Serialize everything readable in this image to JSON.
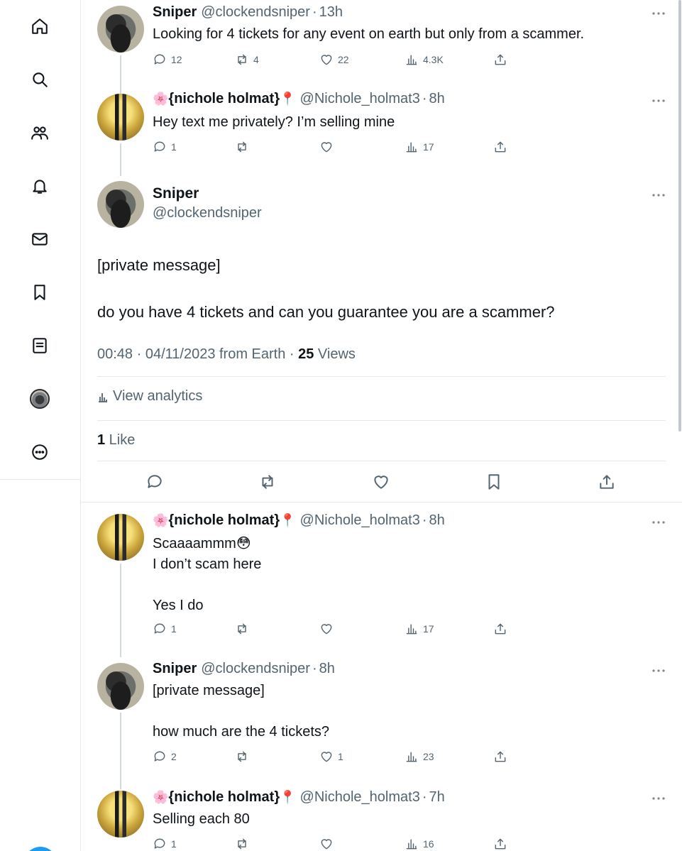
{
  "sidebar": {
    "items": [
      {
        "name": "home",
        "icon": "home-icon"
      },
      {
        "name": "explore",
        "icon": "search-icon"
      },
      {
        "name": "communities",
        "icon": "people-icon"
      },
      {
        "name": "notifications",
        "icon": "bell-icon"
      },
      {
        "name": "messages",
        "icon": "mail-icon"
      },
      {
        "name": "bookmarks",
        "icon": "bookmark-icon"
      },
      {
        "name": "lists",
        "icon": "list-icon"
      },
      {
        "name": "profile",
        "icon": "avatar"
      },
      {
        "name": "more",
        "icon": "more-circle-icon"
      }
    ]
  },
  "tweets": [
    {
      "name": "Sniper",
      "handle": "@clockendsniper",
      "dot": "·",
      "time": "13h",
      "text": "Looking for 4 tickets for any event on earth but only from a scammer.",
      "replies": "12",
      "retweets": "4",
      "likes": "22",
      "views": "4.3K"
    },
    {
      "name": "{nichole holmat}",
      "handle": "@Nichole_holmat3",
      "dot": "·",
      "time": "8h",
      "prefix_emoji": "🌸",
      "suffix_emoji": "📍",
      "text": "Hey text me privately? I’m selling mine",
      "replies": "1",
      "retweets": "",
      "likes": "",
      "views": "17"
    },
    {
      "name": "{nichole holmat}",
      "handle": "@Nichole_holmat3",
      "dot": "·",
      "time": "8h",
      "prefix_emoji": "🌸",
      "suffix_emoji": "📍",
      "text": "Scaaaammm😳\nI don’t scam here\n\nYes I do",
      "replies": "1",
      "retweets": "",
      "likes": "",
      "views": "17"
    },
    {
      "name": "Sniper",
      "handle": "@clockendsniper",
      "dot": "·",
      "time": "8h",
      "text": "[private message]\n\nhow much are the 4 tickets?",
      "replies": "2",
      "retweets": "",
      "likes": "1",
      "views": "23"
    },
    {
      "name": "{nichole holmat}",
      "handle": "@Nichole_holmat3",
      "dot": "·",
      "time": "7h",
      "prefix_emoji": "🌸",
      "suffix_emoji": "📍",
      "text": "Selling each 80",
      "replies": "1",
      "retweets": "",
      "likes": "",
      "views": "16"
    }
  ],
  "focused": {
    "name": "Sniper",
    "handle": "@clockendsniper",
    "text": "[private message]\n\ndo you have 4 tickets and can you guarantee you are a scammer?",
    "timestamp": "00:48 · 04/11/2023 from Earth · ",
    "views_count": "25",
    "views_label": " Views",
    "analytics_label": "View analytics",
    "likes_count": "1",
    "likes_label": " Like"
  },
  "colors": {
    "text": "#0f1419",
    "muted": "#536471",
    "accent": "#1d9bf0",
    "divider": "#e6e9ec"
  }
}
